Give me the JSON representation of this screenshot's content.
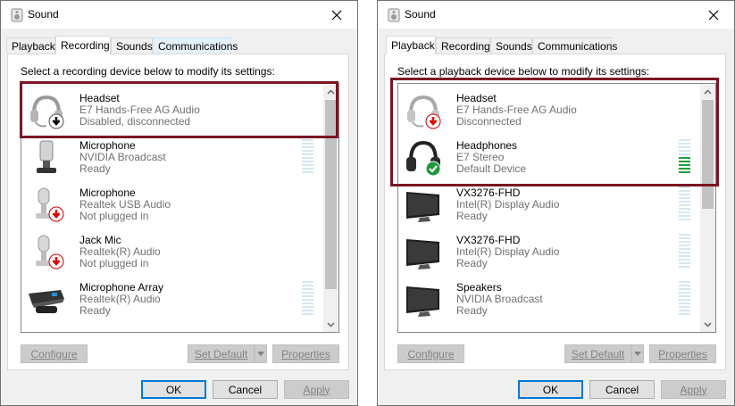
{
  "recording_window": {
    "title": "Sound",
    "tabs": [
      {
        "label": "Playback"
      },
      {
        "label": "Recording"
      },
      {
        "label": "Sounds"
      },
      {
        "label": "Communications"
      }
    ],
    "prompt": "Select a recording device below to modify its settings:",
    "devices": [
      {
        "name": "Headset",
        "desc": "E7 Hands-Free AG Audio",
        "status": "Disabled, disconnected",
        "icon": "headset-disabled-icon"
      },
      {
        "name": "Microphone",
        "desc": "NVIDIA Broadcast",
        "status": "Ready",
        "icon": "microphone-icon"
      },
      {
        "name": "Microphone",
        "desc": "Realtek USB Audio",
        "status": "Not plugged in",
        "icon": "microphone-unplugged-icon"
      },
      {
        "name": "Jack Mic",
        "desc": "Realtek(R) Audio",
        "status": "Not plugged in",
        "icon": "microphone-unplugged-icon"
      },
      {
        "name": "Microphone Array",
        "desc": "Realtek(R) Audio",
        "status": "Ready",
        "icon": "microphone-array-icon"
      }
    ],
    "buttons": {
      "configure": "Configure",
      "set_default": "Set Default",
      "properties": "Properties",
      "ok": "OK",
      "cancel": "Cancel",
      "apply": "Apply"
    }
  },
  "playback_window": {
    "title": "Sound",
    "tabs": [
      {
        "label": "Playback"
      },
      {
        "label": "Recording"
      },
      {
        "label": "Sounds"
      },
      {
        "label": "Communications"
      }
    ],
    "prompt": "Select a playback device below to modify its settings:",
    "devices": [
      {
        "name": "Headset",
        "desc": "E7 Hands-Free AG Audio",
        "status": "Disconnected",
        "icon": "headset-disconnected-icon"
      },
      {
        "name": "Headphones",
        "desc": "E7 Stereo",
        "status": "Default Device",
        "icon": "headphones-default-icon",
        "level": 0.45
      },
      {
        "name": "VX3276-FHD",
        "desc": "Intel(R) Display Audio",
        "status": "Ready",
        "icon": "monitor-icon"
      },
      {
        "name": "VX3276-FHD",
        "desc": "Intel(R) Display Audio",
        "status": "Ready",
        "icon": "monitor-icon"
      },
      {
        "name": "Speakers",
        "desc": "NVIDIA Broadcast",
        "status": "Ready",
        "icon": "monitor-icon"
      }
    ],
    "buttons": {
      "configure": "Configure",
      "set_default": "Set Default",
      "properties": "Properties",
      "ok": "OK",
      "cancel": "Cancel",
      "apply": "Apply"
    }
  }
}
